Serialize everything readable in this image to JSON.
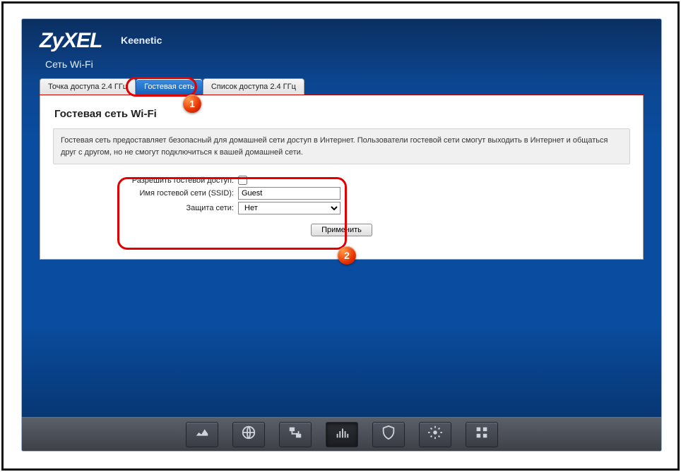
{
  "brand": "ZyXEL",
  "model": "Keenetic",
  "section": "Сеть Wi-Fi",
  "tabs": [
    {
      "label": "Точка доступа 2.4 ГГц"
    },
    {
      "label": "Гостевая сеть"
    },
    {
      "label": "Список доступа 2.4 ГГц"
    }
  ],
  "panel": {
    "title": "Гостевая сеть Wi-Fi",
    "description": "Гостевая сеть предоставляет безопасный для домашней сети доступ в Интернет. Пользователи гостевой сети смогут выходить в Интернет и общаться друг с другом, но не смогут подключиться к вашей домашней сети."
  },
  "form": {
    "allow_label": "Разрешить гостевой доступ:",
    "allow_checked": false,
    "ssid_label": "Имя гостевой сети (SSID):",
    "ssid_value": "Guest",
    "security_label": "Защита сети:",
    "security_value": "Нет",
    "submit": "Применить"
  },
  "dock": [
    {
      "name": "monitor",
      "active": false
    },
    {
      "name": "globe",
      "active": false
    },
    {
      "name": "network",
      "active": false
    },
    {
      "name": "wifi",
      "active": true
    },
    {
      "name": "shield",
      "active": false
    },
    {
      "name": "gear",
      "active": false
    },
    {
      "name": "apps",
      "active": false
    }
  ],
  "badges": {
    "one": "1",
    "two": "2"
  }
}
